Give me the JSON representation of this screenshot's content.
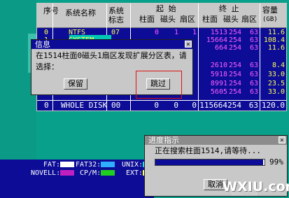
{
  "table": {
    "headers": {
      "seq": "序号",
      "name": "系统名称",
      "id": "系统标志",
      "start": "起 始",
      "end": "终 止",
      "cylinder": "柱面",
      "head": "磁头",
      "sector": "扇区",
      "capacity": "容量",
      "unit": "(GB)"
    },
    "rows": [
      {
        "num": "0",
        "name": "NTFS",
        "id": "07",
        "cyl1": "0",
        "hd1": "1",
        "sec1": "1",
        "cyl2": "1513",
        "hd2": "254",
        "sec2": "63",
        "cap": "11.6"
      },
      {
        "num": "1",
        "name": "SYSTEM",
        "id": "",
        "cyl1": "",
        "hd1": "",
        "sec1": "",
        "cyl2": "15664",
        "hd2": "254",
        "sec2": "63",
        "cap": "108.4"
      },
      {
        "num": "",
        "name": "",
        "id": "",
        "cyl1": "",
        "hd1": "",
        "sec1": "",
        "cyl2": "664",
        "hd2": "254",
        "sec2": "63",
        "cap": "11.6"
      },
      {
        "num": "",
        "name": "",
        "id": "",
        "cyl1": "",
        "hd1": "",
        "sec1": "",
        "cyl2": "",
        "hd2": "",
        "sec2": "",
        "cap": "",
        "white": false
      },
      {
        "num": "",
        "name": "",
        "id": "",
        "cyl1": "",
        "hd1": "",
        "sec1": "",
        "cyl2": "2610",
        "hd2": "254",
        "sec2": "63",
        "cap": "8.4"
      },
      {
        "num": "",
        "name": "",
        "id": "",
        "cyl1": "",
        "hd1": "",
        "sec1": "",
        "cyl2": "5918",
        "hd2": "254",
        "sec2": "63",
        "cap": "33.0"
      },
      {
        "num": "",
        "name": "",
        "id": "",
        "cyl1": "",
        "hd1": "",
        "sec1": "",
        "cyl2": "8991",
        "hd2": "254",
        "sec2": "63",
        "cap": "23.5"
      },
      {
        "num": "",
        "name": "",
        "id": "",
        "cyl1": "",
        "hd1": "",
        "sec1": "",
        "cyl2": "5605",
        "hd2": "254",
        "sec2": "63",
        "cap": "33.0"
      }
    ],
    "whole_disk": {
      "num": "0",
      "name": "WHOLE DISK",
      "id": "00",
      "cyl1": "0",
      "hd1": "0",
      "sec1": "0",
      "cyl2": "115664",
      "hd2": "254",
      "sec2": "63",
      "cap": "120.0"
    }
  },
  "info_dialog": {
    "title": "信息",
    "close": "×",
    "message": "在1514柱面0磁头1扇区发现扩展分区表，请选择：",
    "keep_label": "保留",
    "skip_label": "跳过"
  },
  "legend": {
    "fat": "FAT:",
    "fat32": "FAT32:",
    "unix": "UNIX:",
    "novell": "NOVELL:",
    "cpm": "CP/M:",
    "ext": "EXT:"
  },
  "progress_dialog": {
    "title": "进度指示",
    "close": "×",
    "message": "正在搜索柱面1514,请等待...",
    "percent_label": "99%",
    "progress": 0.99,
    "cancel_label": "取消"
  },
  "watermark": {
    "text": "WXIU.com",
    "subtext": "WXIU.COM"
  },
  "colors": {
    "panel_blue": "#0c0c96",
    "desktop_teal": "#08a08a",
    "highlight_red": "#e01010"
  }
}
